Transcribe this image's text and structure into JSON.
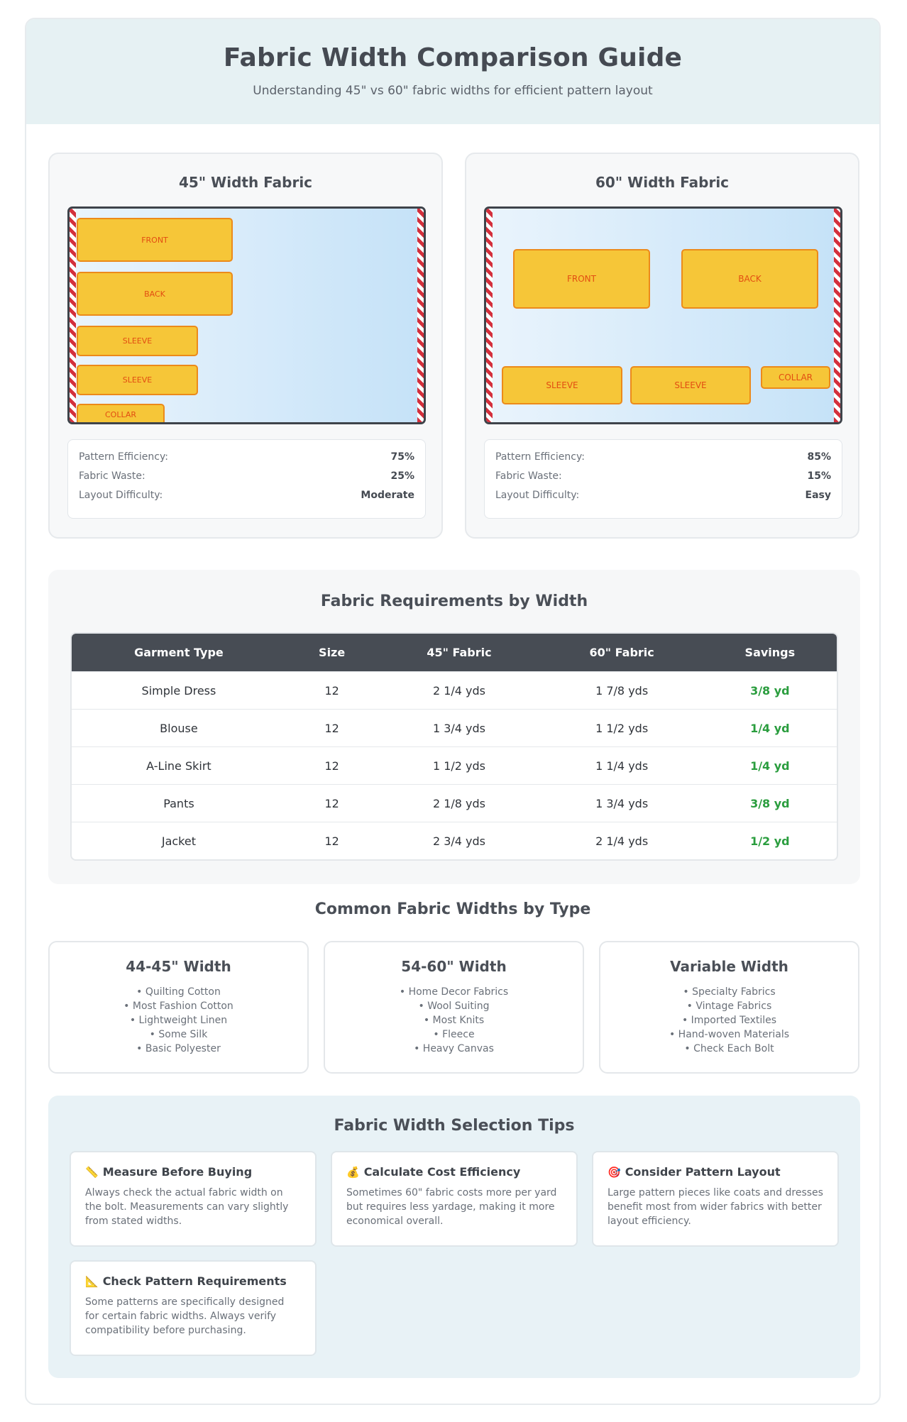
{
  "header": {
    "title": "Fabric Width Comparison Guide",
    "subtitle": "Understanding 45\" vs 60\" fabric widths for efficient pattern layout"
  },
  "panels": [
    {
      "title": "45\" Width Fabric",
      "pieces": [
        "FRONT",
        "BACK",
        "SLEEVE",
        "SLEEVE",
        "COLLAR"
      ],
      "stats": [
        {
          "label": "Pattern Efficiency:",
          "value": "75%"
        },
        {
          "label": "Fabric Waste:",
          "value": "25%"
        },
        {
          "label": "Layout Difficulty:",
          "value": "Moderate"
        }
      ]
    },
    {
      "title": "60\" Width Fabric",
      "pieces": [
        "FRONT",
        "BACK",
        "SLEEVE",
        "SLEEVE",
        "COLLAR"
      ],
      "stats": [
        {
          "label": "Pattern Efficiency:",
          "value": "85%"
        },
        {
          "label": "Fabric Waste:",
          "value": "15%"
        },
        {
          "label": "Layout Difficulty:",
          "value": "Easy"
        }
      ]
    }
  ],
  "requirements": {
    "title": "Fabric Requirements by Width",
    "headers": [
      "Garment Type",
      "Size",
      "45\" Fabric",
      "60\" Fabric",
      "Savings"
    ],
    "rows": [
      [
        "Simple Dress",
        "12",
        "2 1/4 yds",
        "1 7/8 yds",
        "3/8 yd"
      ],
      [
        "Blouse",
        "12",
        "1 3/4 yds",
        "1 1/2 yds",
        "1/4 yd"
      ],
      [
        "A-Line Skirt",
        "12",
        "1 1/2 yds",
        "1 1/4 yds",
        "1/4 yd"
      ],
      [
        "Pants",
        "12",
        "2 1/8 yds",
        "1 3/4 yds",
        "3/8 yd"
      ],
      [
        "Jacket",
        "12",
        "2 3/4 yds",
        "2 1/4 yds",
        "1/2 yd"
      ]
    ]
  },
  "widths": {
    "title": "Common Fabric Widths by Type",
    "cards": [
      {
        "title": "44-45\" Width",
        "items": [
          "• Quilting Cotton",
          "• Most Fashion Cotton",
          "• Lightweight Linen",
          "• Some Silk",
          "• Basic Polyester"
        ]
      },
      {
        "title": "54-60\" Width",
        "items": [
          "• Home Decor Fabrics",
          "• Wool Suiting",
          "• Most Knits",
          "• Fleece",
          "• Heavy Canvas"
        ]
      },
      {
        "title": "Variable Width",
        "items": [
          "• Specialty Fabrics",
          "• Vintage Fabrics",
          "• Imported Textiles",
          "• Hand-woven Materials",
          "• Check Each Bolt"
        ]
      }
    ]
  },
  "tips": {
    "title": "Fabric Width Selection Tips",
    "items": [
      {
        "icon": "📏",
        "title": "Measure Before Buying",
        "text": "Always check the actual fabric width on the bolt. Measurements can vary slightly from stated widths."
      },
      {
        "icon": "💰",
        "title": "Calculate Cost Efficiency",
        "text": "Sometimes 60\" fabric costs more per yard but requires less yardage, making it more economical overall."
      },
      {
        "icon": "🎯",
        "title": "Consider Pattern Layout",
        "text": "Large pattern pieces like coats and dresses benefit most from wider fabrics with better layout efficiency."
      },
      {
        "icon": "📐",
        "title": "Check Pattern Requirements",
        "text": "Some patterns are specifically designed for certain fabric widths. Always verify compatibility before purchasing."
      }
    ]
  }
}
